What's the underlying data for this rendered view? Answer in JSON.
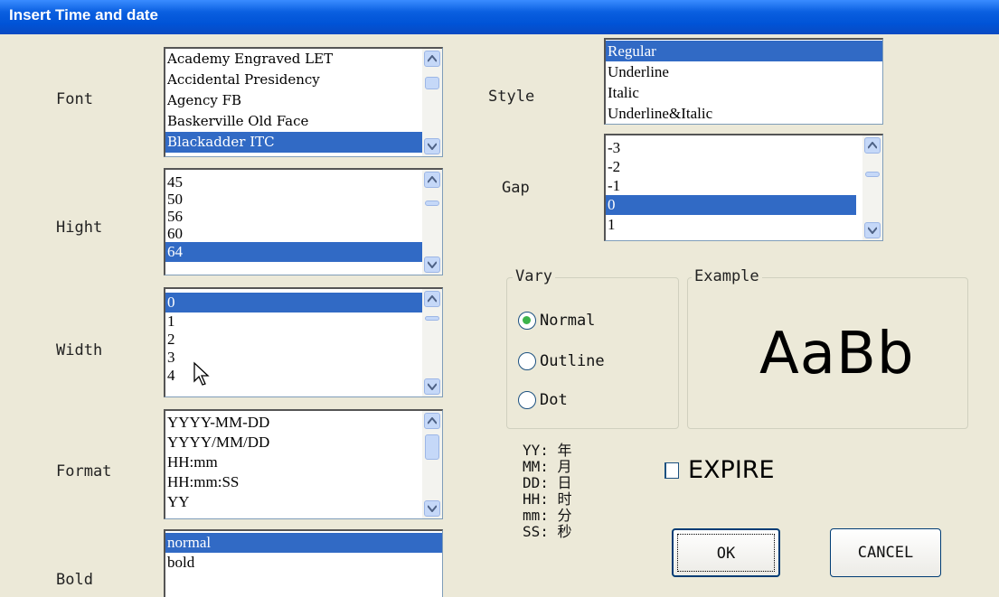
{
  "window": {
    "title": "Insert Time and date"
  },
  "labels": {
    "font": "Font",
    "height": "Hight",
    "width": "Width",
    "format": "Format",
    "bold": "Bold",
    "style": "Style",
    "gap": "Gap"
  },
  "font_list": {
    "items": [
      "Academy Engraved LET",
      "Accidental Presidency",
      "Agency FB",
      "Baskerville Old Face",
      "Blackadder ITC"
    ],
    "selected": "Blackadder ITC"
  },
  "height_list": {
    "items": [
      "45",
      "50",
      "56",
      "60",
      "64"
    ],
    "selected": "64"
  },
  "width_list": {
    "items": [
      "0",
      "1",
      "2",
      "3",
      "4"
    ],
    "selected": "0"
  },
  "format_list": {
    "items": [
      "YYYY-MM-DD",
      "YYYY/MM/DD",
      "HH:mm",
      "HH:mm:SS",
      "YY"
    ]
  },
  "bold_list": {
    "items": [
      "normal",
      "bold"
    ],
    "selected": "normal"
  },
  "style_list": {
    "items": [
      "Regular",
      "Underline",
      "Italic",
      "Underline&Italic"
    ],
    "selected": "Regular"
  },
  "gap_list": {
    "items": [
      "-3",
      "-2",
      "-1",
      "0",
      "1"
    ],
    "selected": "0"
  },
  "vary": {
    "legend": "Vary",
    "options": [
      "Normal",
      "Outline",
      "Dot"
    ],
    "selected": "Normal"
  },
  "example": {
    "legend": "Example",
    "preview": "AaBb"
  },
  "format_legend": [
    "YY: 年",
    "MM: 月",
    "DD: 日",
    "HH: 时",
    "mm: 分",
    "SS: 秒"
  ],
  "expire": {
    "label": "EXPIRE",
    "checked": false
  },
  "buttons": {
    "ok": "OK",
    "cancel": "CANCEL"
  },
  "colors": {
    "selection": "#316ac5",
    "titlebar": "#0053d6",
    "radio_dot": "#3cb34a"
  }
}
